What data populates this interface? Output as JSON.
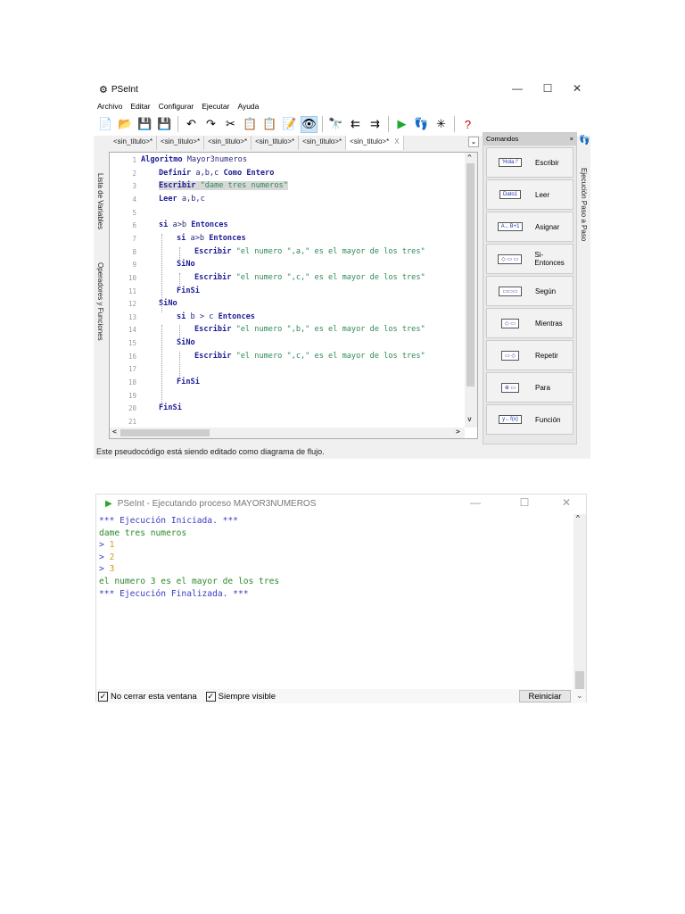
{
  "editor_window": {
    "title": "PSeInt",
    "controls": {
      "minimize": "—",
      "maximize": "☐",
      "close": "✕"
    },
    "menu": [
      "Archivo",
      "Editar",
      "Configurar",
      "Ejecutar",
      "Ayuda"
    ],
    "toolbar": [
      {
        "name": "new-file",
        "g": "📄"
      },
      {
        "name": "open",
        "g": "📂"
      },
      {
        "name": "save",
        "g": "💾"
      },
      {
        "name": "save-as",
        "g": "💾"
      },
      "sep",
      {
        "name": "undo",
        "g": "↶"
      },
      {
        "name": "redo",
        "g": "↷"
      },
      {
        "name": "cut",
        "g": "✂"
      },
      {
        "name": "copy",
        "g": "📋"
      },
      {
        "name": "paste",
        "g": "📋"
      },
      {
        "name": "correct-indent",
        "g": "📝"
      },
      {
        "name": "flowchart-view",
        "g": "👁",
        "on": true
      },
      "sep",
      {
        "name": "find",
        "g": "🔭"
      },
      {
        "name": "find-previous",
        "g": "⇇"
      },
      {
        "name": "find-next",
        "g": "⇉"
      },
      "sep",
      {
        "name": "run",
        "g": "▶",
        "c": "#1aaa2a"
      },
      {
        "name": "step-by-step",
        "g": "👣"
      },
      {
        "name": "draw-flowchart",
        "g": "✳"
      },
      "sep",
      {
        "name": "help",
        "g": "?",
        "c": "#c00"
      }
    ],
    "tabs": [
      "<sin_titulo>*",
      "<sin_titulo>*",
      "<sin_titulo>*",
      "<sin_titulo>*",
      "<sin_titulo>*",
      "<sin_titulo>*"
    ],
    "tab_close": "X",
    "left_sidebar": [
      "Lista de Variables",
      "Operadores y Funciones"
    ],
    "right_strip": "Ejecución Paso a Paso",
    "code": [
      {
        "n": "1",
        "i": 0,
        "s": [
          [
            "kw",
            "Algoritmo "
          ],
          [
            "id",
            "Mayor3numeros"
          ]
        ]
      },
      {
        "n": "2",
        "i": 1,
        "s": [
          [
            "kw",
            "Definir "
          ],
          [
            "id",
            "a,b,c "
          ],
          [
            "kw",
            "Como Entero"
          ]
        ]
      },
      {
        "n": "3",
        "i": 1,
        "h": true,
        "s": [
          [
            "kw",
            "Escribir "
          ],
          [
            "str",
            "\"dame tres numeros\""
          ]
        ]
      },
      {
        "n": "4",
        "i": 1,
        "s": [
          [
            "kw",
            "Leer "
          ],
          [
            "id",
            "a,b,c"
          ]
        ]
      },
      {
        "n": "5",
        "i": 0,
        "s": []
      },
      {
        "n": "6",
        "i": 1,
        "s": [
          [
            "kw",
            "si "
          ],
          [
            "id",
            "a>b "
          ],
          [
            "kw",
            "Entonces"
          ]
        ]
      },
      {
        "n": "7",
        "i": 2,
        "s": [
          [
            "kw",
            "si "
          ],
          [
            "id",
            "a>b "
          ],
          [
            "kw",
            "Entonces"
          ]
        ]
      },
      {
        "n": "8",
        "i": 3,
        "s": [
          [
            "kw",
            "Escribir "
          ],
          [
            "str",
            "\"el numero \",a,\" es el mayor de los tres\""
          ]
        ]
      },
      {
        "n": "9",
        "i": 2,
        "s": [
          [
            "kw",
            "SiNo"
          ]
        ]
      },
      {
        "n": "10",
        "i": 3,
        "s": [
          [
            "kw",
            "Escribir "
          ],
          [
            "str",
            "\"el numero \",c,\" es el mayor de los tres\""
          ]
        ]
      },
      {
        "n": "11",
        "i": 2,
        "s": [
          [
            "kw",
            "FinSi"
          ]
        ]
      },
      {
        "n": "12",
        "i": 1,
        "s": [
          [
            "kw",
            "SiNo"
          ]
        ]
      },
      {
        "n": "13",
        "i": 2,
        "s": [
          [
            "kw",
            "si "
          ],
          [
            "id",
            "b > c "
          ],
          [
            "kw",
            "Entonces"
          ]
        ]
      },
      {
        "n": "14",
        "i": 3,
        "s": [
          [
            "kw",
            "Escribir "
          ],
          [
            "str",
            "\"el numero \",b,\" es el mayor de los tres\""
          ]
        ]
      },
      {
        "n": "15",
        "i": 2,
        "s": [
          [
            "kw",
            "SiNo"
          ]
        ]
      },
      {
        "n": "16",
        "i": 3,
        "s": [
          [
            "kw",
            "Escribir "
          ],
          [
            "str",
            "\"el numero \",c,\" es el mayor de los tres\""
          ]
        ]
      },
      {
        "n": "17",
        "i": 0,
        "s": []
      },
      {
        "n": "18",
        "i": 2,
        "s": [
          [
            "kw",
            "FinSi"
          ]
        ]
      },
      {
        "n": "19",
        "i": 0,
        "s": []
      },
      {
        "n": "20",
        "i": 1,
        "s": [
          [
            "kw",
            "FinSi"
          ]
        ]
      },
      {
        "n": "21",
        "i": 0,
        "s": []
      }
    ],
    "commands": {
      "title": "Comandos",
      "close": "×",
      "items": [
        {
          "label": "Escribir",
          "icon": "'Hola !'"
        },
        {
          "label": "Leer",
          "icon": "Dato1"
        },
        {
          "label": "Asignar",
          "icon": "A←B+1"
        },
        {
          "label": "Si-Entonces",
          "icon": "◇ ▭ ▭"
        },
        {
          "label": "Según",
          "icon": "▭▭▭"
        },
        {
          "label": "Mientras",
          "icon": "◇ ▭"
        },
        {
          "label": "Repetir",
          "icon": "▭ ◇"
        },
        {
          "label": "Para",
          "icon": "⊕ ▭"
        },
        {
          "label": "Función",
          "icon": "y←f(x)"
        }
      ]
    },
    "status": "Este pseudocódigo está siendo editado como diagrama de flujo."
  },
  "run_window": {
    "title": "PSeInt - Ejecutando proceso MAYOR3NUMEROS",
    "controls": {
      "minimize": "—",
      "maximize": "☐",
      "close": "✕"
    },
    "output": [
      {
        "t": "*** Ejecución Iniciada. ***",
        "c": "blue"
      },
      {
        "t": "dame tres numeros",
        "c": "green"
      },
      {
        "p": "> ",
        "t": "1",
        "c": "orange"
      },
      {
        "p": "> ",
        "t": "2",
        "c": "orange"
      },
      {
        "p": "> ",
        "t": "3",
        "c": "orange"
      },
      {
        "t": "el numero 3 es el mayor de los tres",
        "c": "green"
      },
      {
        "t": "*** Ejecución Finalizada. ***",
        "c": "blue"
      }
    ],
    "no_cerrar": {
      "label": "No cerrar esta ventana",
      "checked": true
    },
    "siempre_visible": {
      "label": "Siempre visible",
      "checked": true
    },
    "reiniciar": "Reiniciar",
    "check_glyph": "✓"
  }
}
